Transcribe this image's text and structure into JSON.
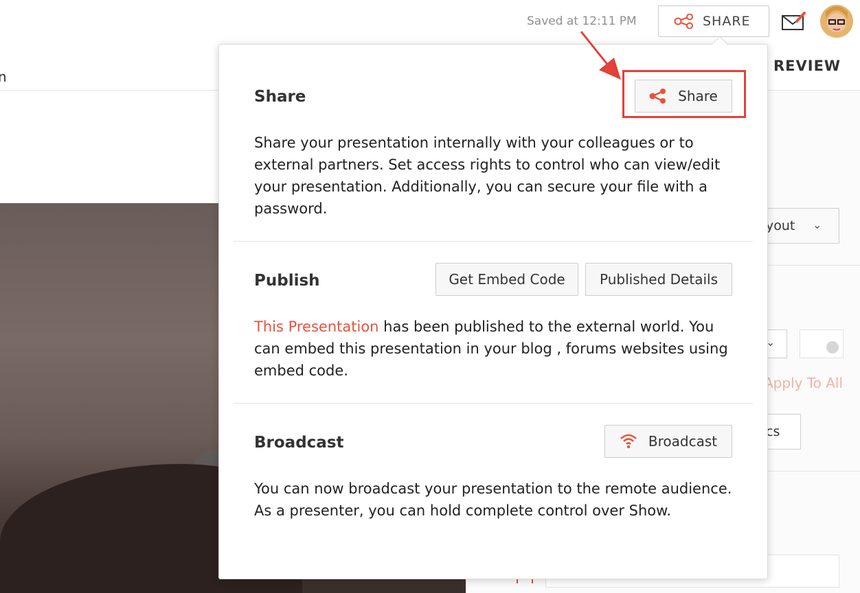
{
  "header": {
    "saved_status": "Saved at 12:11 PM",
    "share_label": "SHARE",
    "review_tab": "REVIEW",
    "left_fragment": "n"
  },
  "popup": {
    "share": {
      "title": "Share",
      "button_label": "Share",
      "description": "Share your presentation internally with your colleagues or to external partners. Set access rights to control who can view/edit your presentation. Additionally, you can secure your file with a password."
    },
    "publish": {
      "title": "Publish",
      "embed_button": "Get Embed Code",
      "details_button": "Published Details",
      "link_text": "This Presentation",
      "description_rest": " has been published to the external world. You can embed this presentation in your blog , forums websites using embed code."
    },
    "broadcast": {
      "title": "Broadcast",
      "button_label": "Broadcast",
      "description": "You can now broadcast your presentation to the remote audience. As a presenter, you can hold complete control over Show."
    }
  },
  "right_panel": {
    "layout_fragment": "yout",
    "apply_to_all": "Apply To All",
    "button_fragment": "cs"
  },
  "colors": {
    "accent": "#e8533b",
    "highlight": "#e5403a"
  },
  "icons": [
    "share-icon",
    "mail-edit-icon",
    "avatar",
    "broadcast-icon",
    "chevron-down-icon",
    "annotation-arrow"
  ]
}
